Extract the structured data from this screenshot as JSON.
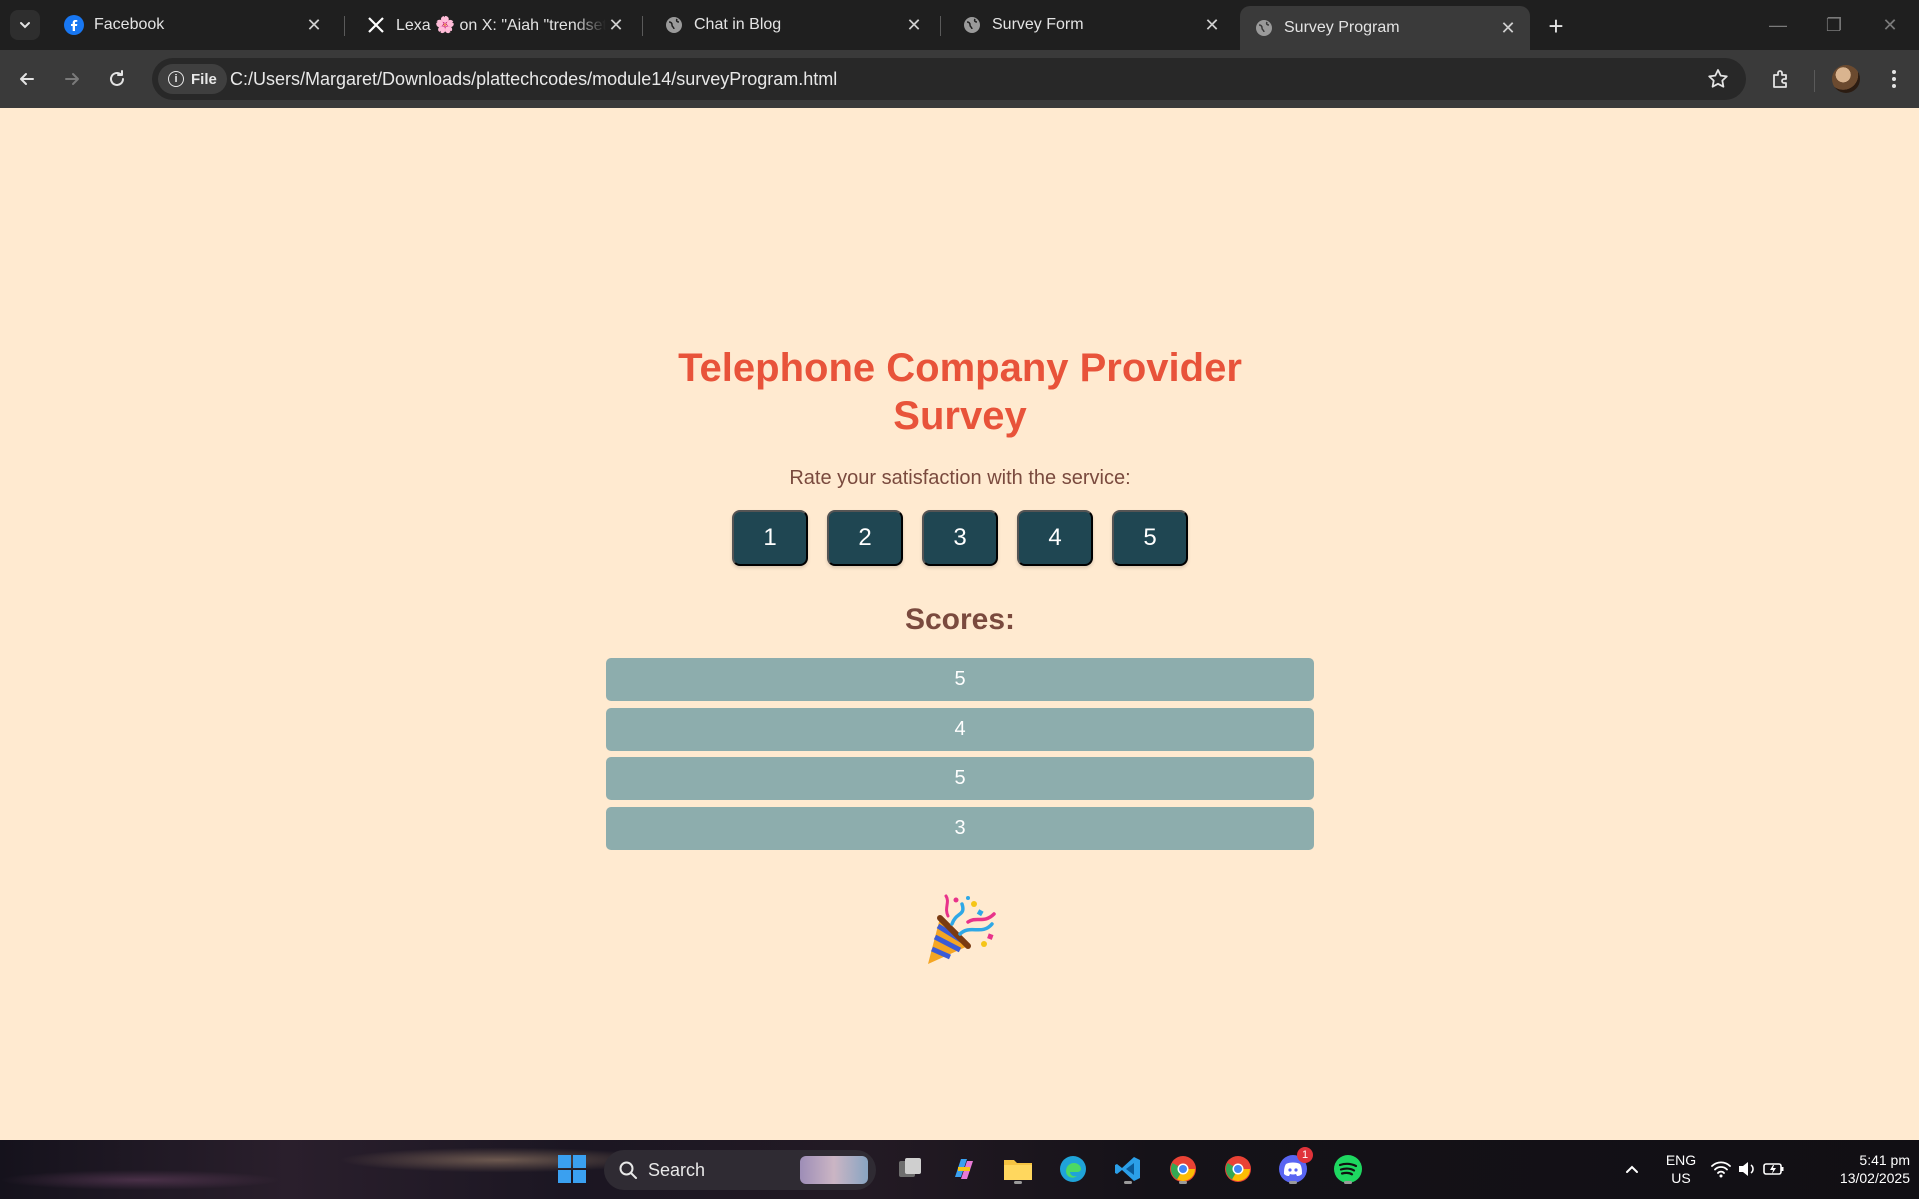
{
  "browser": {
    "tabs": [
      {
        "title": "Facebook",
        "icon": "facebook-icon",
        "active": false
      },
      {
        "title": "Lexa 🌸 on X: \"Aiah \"trendsetter\"",
        "icon": "x-logo-icon",
        "active": false
      },
      {
        "title": "Chat in Blog",
        "icon": "globe-icon",
        "active": false
      },
      {
        "title": "Survey Form",
        "icon": "globe-icon",
        "active": false
      },
      {
        "title": "Survey Program",
        "icon": "globe-icon",
        "active": true
      }
    ],
    "address": {
      "scheme_chip": "File",
      "url": "C:/Users/Margaret/Downloads/plattechcodes/module14/surveyProgram.html"
    }
  },
  "page": {
    "title": "Telephone Company Provider Survey",
    "prompt": "Rate your satisfaction with the service:",
    "rating_buttons": [
      "1",
      "2",
      "3",
      "4",
      "5"
    ],
    "scores_heading": "Scores:",
    "scores": [
      "5",
      "4",
      "5",
      "3"
    ],
    "celebration_icon": "party-popper-icon",
    "colors": {
      "background": "#ffead0",
      "title": "#e8533a",
      "text": "#7a4a3e",
      "button": "#1f4652",
      "score_bar": "#8dadad"
    }
  },
  "taskbar": {
    "search_label": "Search",
    "language": "ENG",
    "region": "US",
    "time": "5:41 pm",
    "date": "13/02/2025",
    "discord_badge": "1"
  }
}
